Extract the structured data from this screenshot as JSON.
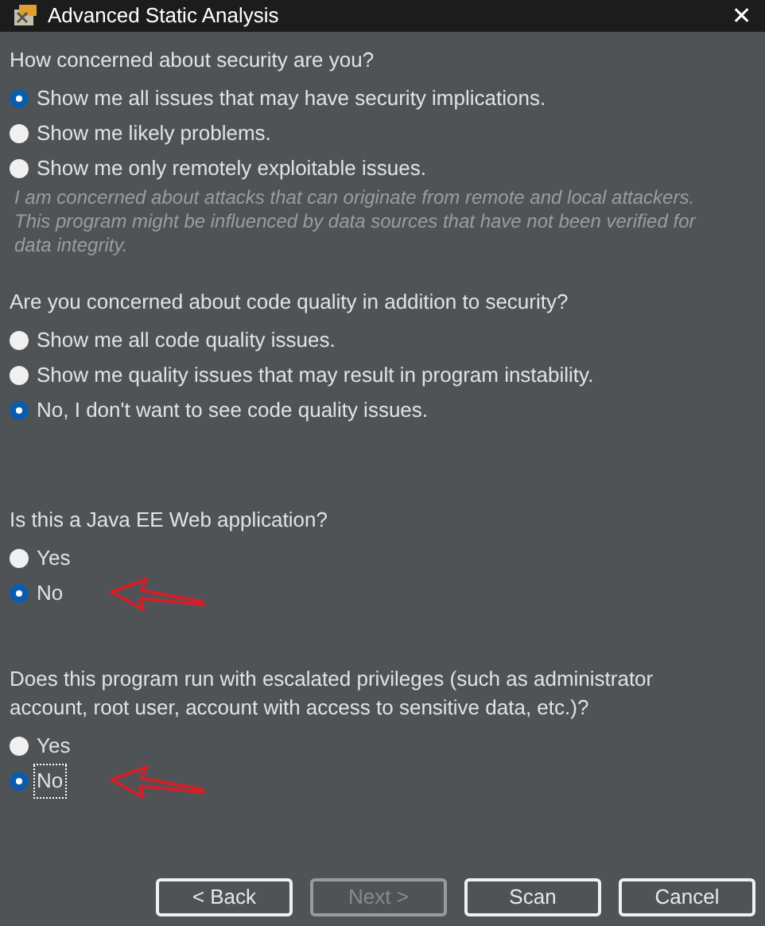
{
  "window": {
    "title": "Advanced Static Analysis",
    "close": "✕"
  },
  "questions": [
    {
      "text": "How concerned about security are you?",
      "options": [
        {
          "label": "Show me all issues that may have security implications.",
          "selected": true,
          "marked": false,
          "focused": false
        },
        {
          "label": "Show me likely problems.",
          "selected": false,
          "marked": false,
          "focused": false
        },
        {
          "label": "Show me only remotely exploitable issues.",
          "selected": false,
          "marked": false,
          "focused": false
        }
      ],
      "note": "I am concerned about attacks that can originate from remote and local attackers. This program might be influenced by data sources that have not been verified for data integrity."
    },
    {
      "text": "Are you concerned about code quality in addition to security?",
      "options": [
        {
          "label": "Show me all code quality issues.",
          "selected": false,
          "marked": false,
          "focused": false
        },
        {
          "label": "Show me quality issues that may result in program instability.",
          "selected": false,
          "marked": false,
          "focused": false
        },
        {
          "label": "No, I don't want to see code quality issues.",
          "selected": true,
          "marked": false,
          "focused": false
        }
      ]
    },
    {
      "text": "Is this a Java EE Web application?",
      "options": [
        {
          "label": "Yes",
          "selected": false,
          "marked": false,
          "focused": false
        },
        {
          "label": "No",
          "selected": true,
          "marked": true,
          "focused": false
        }
      ]
    },
    {
      "text": "Does this program run with escalated privileges (such as administrator account, root user, account with access to sensitive data, etc.)?",
      "options": [
        {
          "label": "Yes",
          "selected": false,
          "marked": false,
          "focused": false
        },
        {
          "label": "No",
          "selected": true,
          "marked": true,
          "focused": true
        }
      ]
    }
  ],
  "buttons": [
    {
      "label": "< Back",
      "disabled": false
    },
    {
      "label": "Next >",
      "disabled": true
    },
    {
      "label": "Scan",
      "disabled": false
    },
    {
      "label": "Cancel",
      "disabled": false
    }
  ]
}
